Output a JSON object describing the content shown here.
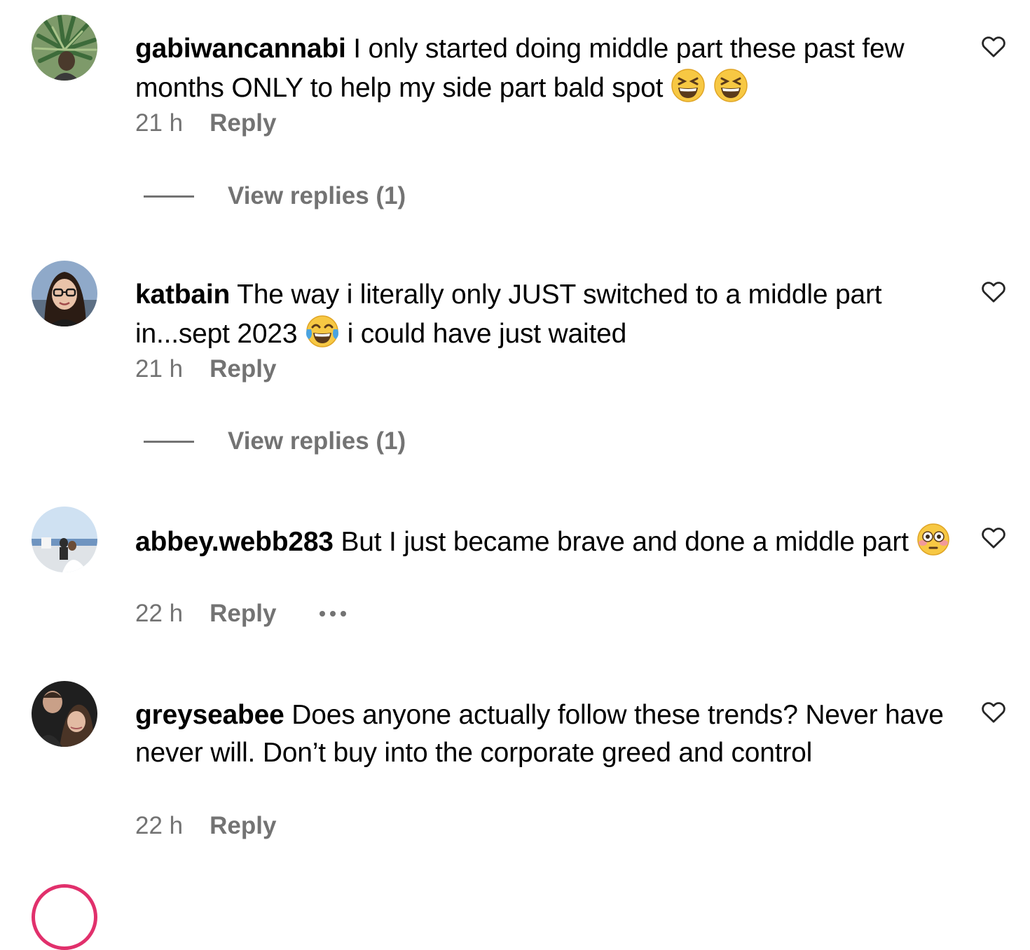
{
  "comments": [
    {
      "username": "gabiwancannabi",
      "text_parts": [
        "I only started doing middle part these past few months ONLY to help my side part bald spot"
      ],
      "emojis": [
        "grinning-squinting-face-emoji",
        "grinning-squinting-face-emoji"
      ],
      "time": "21 h",
      "reply_label": "Reply",
      "view_replies": "View replies (1)"
    },
    {
      "username": "katbain",
      "text_parts": [
        "The way i literally only JUST switched to a middle part in...sept 2023",
        "i could have just waited"
      ],
      "emojis": [
        "tears-of-joy-emoji"
      ],
      "time": "21 h",
      "reply_label": "Reply",
      "view_replies": "View replies (1)"
    },
    {
      "username": "abbey.webb283",
      "text_parts": [
        "But I just became brave and done a middle part"
      ],
      "emojis": [
        "flushed-face-emoji"
      ],
      "time": "22 h",
      "reply_label": "Reply"
    },
    {
      "username": "greyseabee",
      "text_parts": [
        "Does anyone actually follow these trends? Never have never will. Don’t buy into the corporate greed and control"
      ],
      "time": "22 h",
      "reply_label": "Reply"
    }
  ],
  "icons": {
    "like": "heart-outline-icon",
    "more": "more-options-icon"
  },
  "colors": {
    "text": "#000000",
    "secondary": "#737373",
    "background": "#ffffff",
    "story_ring": "#e1306c"
  }
}
